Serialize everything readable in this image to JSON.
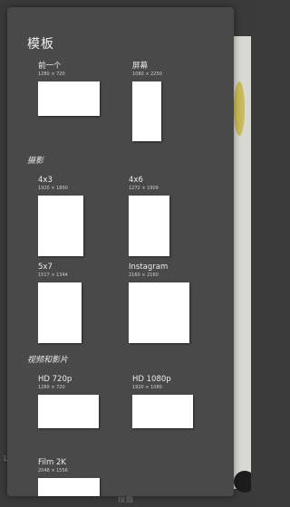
{
  "panel": {
    "title": "模板"
  },
  "sections": [
    {
      "title": "",
      "items": [
        {
          "name": "前一个",
          "size": "1280 × 720"
        },
        {
          "name": "屏幕",
          "size": "1080 × 2250"
        }
      ]
    },
    {
      "title": "摄影",
      "items": [
        {
          "name": "4x3",
          "size": "1920 × 1800"
        },
        {
          "name": "4x6",
          "size": "1272 × 1909"
        },
        {
          "name": "5x7",
          "size": "1517 × 1344"
        },
        {
          "name": "Instagram",
          "size": "2160 × 2160"
        }
      ]
    },
    {
      "title": "视频和影片",
      "items": [
        {
          "name": "HD 720p",
          "size": "1280 × 720"
        },
        {
          "name": "HD 1080p",
          "size": "1920 × 1080"
        },
        {
          "name": "Film 2K",
          "size": "2048 × 1556"
        }
      ]
    }
  ],
  "background": {
    "bottom_label": "设置",
    "left_label": "Lab",
    "accent_color": "#c7b13a"
  }
}
